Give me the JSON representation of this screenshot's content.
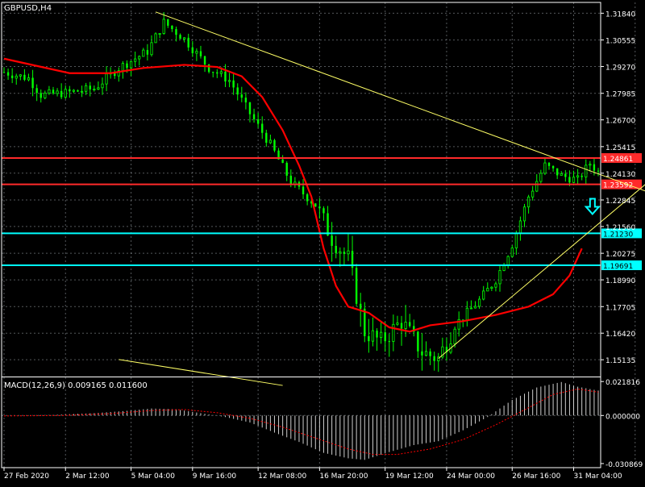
{
  "symbol_label": "GBPUSD,H4",
  "colors": {
    "background": "#000000",
    "grid": "#9aa0a6",
    "axis": "#ffffff",
    "bull_candle": "#00ff00",
    "bear_candle": "#00ff00",
    "moving_average": "#ff0000",
    "resistance": "#ff2a2a",
    "support": "#00ffff",
    "trendline": "#ffff66",
    "arrow": "#00ffff",
    "macd_hist": "#cfcfcf",
    "macd_signal": "#ff0000"
  },
  "chart_data": [
    {
      "type": "candlestick",
      "title": "GBPUSD,H4",
      "y_ticks": [
        1.3184,
        1.3055,
        1.2927,
        1.2798,
        1.267,
        1.2541,
        1.2413,
        1.2284,
        1.2156,
        1.2027,
        1.1899,
        1.177,
        1.1642,
        1.1514
      ],
      "y_tick_labels": [
        "1.31840",
        "1.30555",
        "1.29270",
        "1.27985",
        "1.26700",
        "1.25415",
        "1.24130",
        "1.22845",
        "1.21560",
        "1.20275",
        "1.18990",
        "1.17705",
        "1.16420",
        "1.15135"
      ],
      "ylim": [
        1.1433,
        1.3236
      ],
      "x_tick_labels": [
        "27 Feb 2020",
        "2 Mar 12:00",
        "5 Mar 04:00",
        "9 Mar 16:00",
        "12 Mar 08:00",
        "16 Mar 20:00",
        "19 Mar 12:00",
        "24 Mar 00:00",
        "26 Mar 16:00",
        "31 Mar 04:00"
      ],
      "x_label_bars": [
        0,
        15,
        31,
        46,
        62,
        77,
        93,
        108,
        124,
        139
      ],
      "n_bars": 146,
      "close_path": [
        {
          "bar": 0,
          "price": 1.29
        },
        {
          "bar": 6,
          "price": 1.287
        },
        {
          "bar": 9,
          "price": 1.279
        },
        {
          "bar": 15,
          "price": 1.28
        },
        {
          "bar": 22,
          "price": 1.282
        },
        {
          "bar": 28,
          "price": 1.292
        },
        {
          "bar": 35,
          "price": 1.3
        },
        {
          "bar": 39,
          "price": 1.314
        },
        {
          "bar": 44,
          "price": 1.306
        },
        {
          "bar": 50,
          "price": 1.292
        },
        {
          "bar": 55,
          "price": 1.286
        },
        {
          "bar": 60,
          "price": 1.27
        },
        {
          "bar": 65,
          "price": 1.255
        },
        {
          "bar": 70,
          "price": 1.237
        },
        {
          "bar": 76,
          "price": 1.226
        },
        {
          "bar": 80,
          "price": 1.21
        },
        {
          "bar": 84,
          "price": 1.2
        },
        {
          "bar": 88,
          "price": 1.165
        },
        {
          "bar": 92,
          "price": 1.16
        },
        {
          "bar": 97,
          "price": 1.17
        },
        {
          "bar": 102,
          "price": 1.155
        },
        {
          "bar": 106,
          "price": 1.152
        },
        {
          "bar": 110,
          "price": 1.168
        },
        {
          "bar": 116,
          "price": 1.18
        },
        {
          "bar": 120,
          "price": 1.19
        },
        {
          "bar": 124,
          "price": 1.207
        },
        {
          "bar": 128,
          "price": 1.23
        },
        {
          "bar": 132,
          "price": 1.245
        },
        {
          "bar": 136,
          "price": 1.24
        },
        {
          "bar": 140,
          "price": 1.238
        },
        {
          "bar": 143,
          "price": 1.246
        },
        {
          "bar": 145,
          "price": 1.242
        }
      ],
      "moving_average": [
        {
          "bar": 0,
          "price": 1.2965
        },
        {
          "bar": 8,
          "price": 1.293
        },
        {
          "bar": 16,
          "price": 1.2895
        },
        {
          "bar": 26,
          "price": 1.2895
        },
        {
          "bar": 34,
          "price": 1.292
        },
        {
          "bar": 44,
          "price": 1.2935
        },
        {
          "bar": 52,
          "price": 1.2925
        },
        {
          "bar": 58,
          "price": 1.288
        },
        {
          "bar": 63,
          "price": 1.278
        },
        {
          "bar": 68,
          "price": 1.262
        },
        {
          "bar": 72,
          "price": 1.245
        },
        {
          "bar": 75,
          "price": 1.23
        },
        {
          "bar": 78,
          "price": 1.205
        },
        {
          "bar": 81,
          "price": 1.187
        },
        {
          "bar": 84,
          "price": 1.177
        },
        {
          "bar": 89,
          "price": 1.174
        },
        {
          "bar": 94,
          "price": 1.167
        },
        {
          "bar": 99,
          "price": 1.165
        },
        {
          "bar": 104,
          "price": 1.168
        },
        {
          "bar": 112,
          "price": 1.17
        },
        {
          "bar": 120,
          "price": 1.173
        },
        {
          "bar": 128,
          "price": 1.177
        },
        {
          "bar": 134,
          "price": 1.183
        },
        {
          "bar": 138,
          "price": 1.192
        },
        {
          "bar": 141,
          "price": 1.205
        }
      ],
      "horizontal_levels": [
        {
          "price": 1.24861,
          "label": "1.24861",
          "kind": "resistance"
        },
        {
          "price": 1.23592,
          "label": "1.23592",
          "kind": "resistance"
        },
        {
          "price": 1.2123,
          "label": "1.21230",
          "kind": "support"
        },
        {
          "price": 1.19691,
          "label": "1.19691",
          "kind": "support"
        }
      ],
      "trendlines": [
        {
          "from": {
            "bar": 37,
            "price": 1.319
          },
          "to": {
            "bar": 163,
            "price": 1.228
          }
        },
        {
          "from": {
            "bar": 106,
            "price": 1.152
          },
          "to": {
            "bar": 171,
            "price": 1.26
          }
        },
        {
          "from": {
            "bar": 28,
            "price": 1.1515
          },
          "to": {
            "bar": 68,
            "price": 1.139
          }
        }
      ],
      "arrow": {
        "bar": 143,
        "price": 1.229,
        "direction": "down"
      }
    },
    {
      "type": "histogram",
      "title": "MACD(12,26,9) 0.009165 0.011600",
      "y_tick_labels": [
        "0.021816",
        "0.000000",
        "-0.030869"
      ],
      "y_ticks": [
        0.021816,
        0.0,
        -0.030869
      ],
      "ylim": [
        -0.0335,
        0.0245
      ],
      "histogram_path": [
        {
          "bar": 0,
          "value": 0.0
        },
        {
          "bar": 12,
          "value": 0.0004
        },
        {
          "bar": 22,
          "value": 0.0015
        },
        {
          "bar": 30,
          "value": 0.003
        },
        {
          "bar": 36,
          "value": 0.0045
        },
        {
          "bar": 42,
          "value": 0.004
        },
        {
          "bar": 48,
          "value": 0.0015
        },
        {
          "bar": 54,
          "value": -0.001
        },
        {
          "bar": 60,
          "value": -0.0045
        },
        {
          "bar": 66,
          "value": -0.011
        },
        {
          "bar": 72,
          "value": -0.017
        },
        {
          "bar": 78,
          "value": -0.024
        },
        {
          "bar": 84,
          "value": -0.0275
        },
        {
          "bar": 88,
          "value": -0.0285
        },
        {
          "bar": 94,
          "value": -0.0235
        },
        {
          "bar": 100,
          "value": -0.019
        },
        {
          "bar": 106,
          "value": -0.0165
        },
        {
          "bar": 112,
          "value": -0.0095
        },
        {
          "bar": 118,
          "value": -0.001
        },
        {
          "bar": 124,
          "value": 0.01
        },
        {
          "bar": 130,
          "value": 0.018
        },
        {
          "bar": 136,
          "value": 0.0215
        },
        {
          "bar": 140,
          "value": 0.0185
        },
        {
          "bar": 145,
          "value": 0.016
        }
      ],
      "signal_path": [
        {
          "bar": 0,
          "value": -0.0003
        },
        {
          "bar": 14,
          "value": 0.0
        },
        {
          "bar": 26,
          "value": 0.0012
        },
        {
          "bar": 36,
          "value": 0.0032
        },
        {
          "bar": 44,
          "value": 0.0038
        },
        {
          "bar": 52,
          "value": 0.0018
        },
        {
          "bar": 60,
          "value": -0.0018
        },
        {
          "bar": 68,
          "value": -0.0075
        },
        {
          "bar": 76,
          "value": -0.0145
        },
        {
          "bar": 84,
          "value": -0.0215
        },
        {
          "bar": 90,
          "value": -0.025
        },
        {
          "bar": 96,
          "value": -0.025
        },
        {
          "bar": 104,
          "value": -0.0215
        },
        {
          "bar": 112,
          "value": -0.0155
        },
        {
          "bar": 120,
          "value": -0.006
        },
        {
          "bar": 128,
          "value": 0.005
        },
        {
          "bar": 134,
          "value": 0.0135
        },
        {
          "bar": 140,
          "value": 0.017
        },
        {
          "bar": 145,
          "value": 0.015
        }
      ]
    }
  ]
}
